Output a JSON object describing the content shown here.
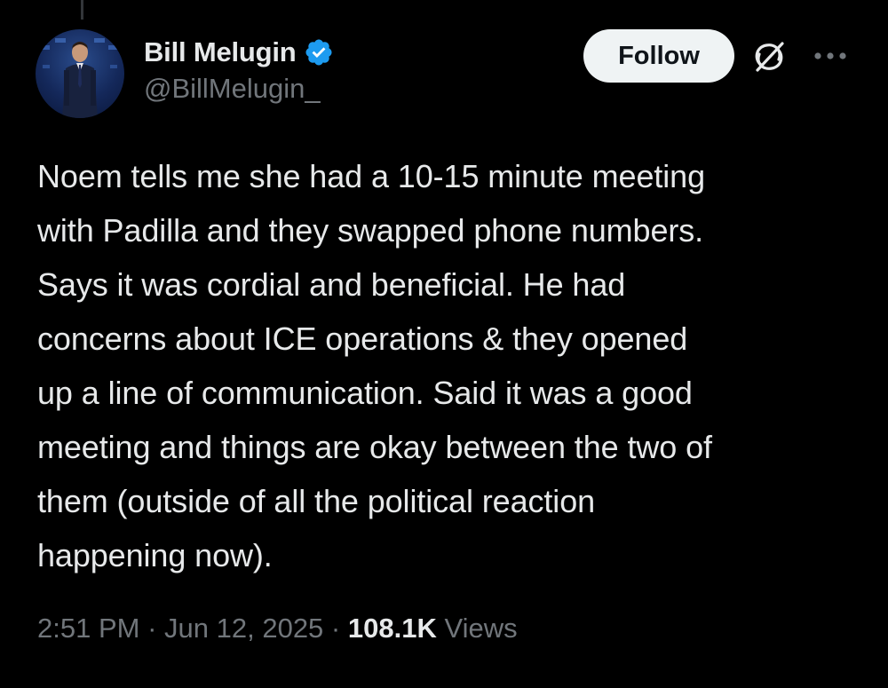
{
  "author": {
    "display_name": "Bill Melugin",
    "handle": "@BillMelugin_",
    "verified": true
  },
  "actions": {
    "follow_label": "Follow",
    "grok_icon": "grok-icon",
    "more_icon": "more-icon"
  },
  "tweet": {
    "text": "Noem tells me she had a 10-15 minute meeting\nwith Padilla and they swapped phone numbers.\nSays it was cordial and beneficial. He had\nconcerns about ICE operations & they opened\nup a line of communication. Said it was a good\nmeeting and things are okay between the two of\nthem (outside of all the political reaction\nhappening now).",
    "time": "2:51 PM",
    "separator": "·",
    "date": "Jun 12, 2025",
    "views_count": "108.1K",
    "views_label": "Views"
  },
  "colors": {
    "background": "#000000",
    "text_primary": "#e7e9ea",
    "text_secondary": "#71767b",
    "verified_badge": "#1d9bf0",
    "follow_button_bg": "#eff3f4"
  }
}
